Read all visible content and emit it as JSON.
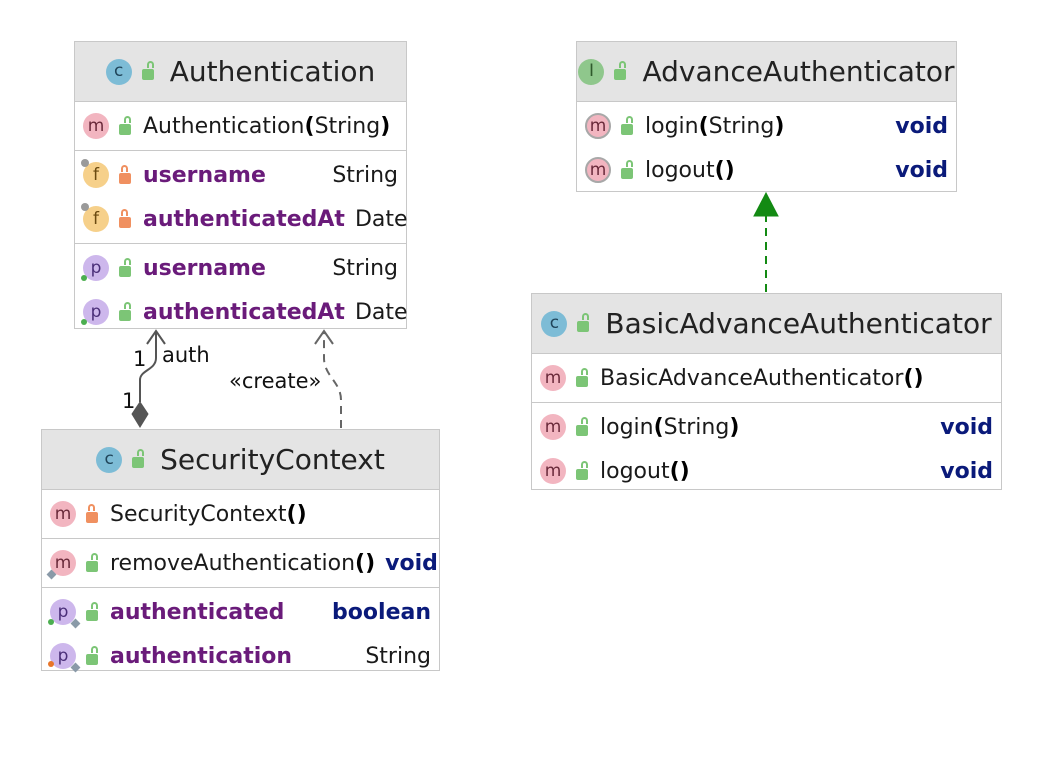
{
  "classes": {
    "authentication": {
      "name": "Authentication",
      "kind_icon": "c-class-icon",
      "constructor": {
        "name": "Authentication",
        "open": "(",
        "params": "String",
        "close": ")"
      },
      "fields": [
        {
          "name": "username",
          "type": "String"
        },
        {
          "name": "authenticatedAt",
          "type": "Date"
        }
      ],
      "properties": [
        {
          "name": "username",
          "type": "String"
        },
        {
          "name": "authenticatedAt",
          "type": "Date"
        }
      ]
    },
    "advance_authenticator": {
      "name": "AdvanceAuthenticator",
      "kind_icon": "i-interface-icon",
      "methods": [
        {
          "name": "login",
          "open": "(",
          "params": "String",
          "close": ")",
          "type": "void"
        },
        {
          "name": "logout",
          "open": "(",
          "params": "",
          "close": ")",
          "type": "void"
        }
      ]
    },
    "basic_advance_authenticator": {
      "name": "BasicAdvanceAuthenticator",
      "kind_icon": "c-class-icon",
      "constructor": {
        "name": "BasicAdvanceAuthenticator",
        "open": "(",
        "params": "",
        "close": ")"
      },
      "methods": [
        {
          "name": "login",
          "open": "(",
          "params": "String",
          "close": ")",
          "type": "void"
        },
        {
          "name": "logout",
          "open": "(",
          "params": "",
          "close": ")",
          "type": "void"
        }
      ]
    },
    "security_context": {
      "name": "SecurityContext",
      "kind_icon": "c-class-icon",
      "constructor": {
        "name": "SecurityContext",
        "open": "(",
        "params": "",
        "close": ")"
      },
      "methods": [
        {
          "name": "removeAuthentication",
          "open": "(",
          "params": "",
          "close": ")",
          "type": "void"
        }
      ],
      "properties": [
        {
          "name": "authenticated",
          "type": "boolean"
        },
        {
          "name": "authentication",
          "type": "String"
        }
      ]
    }
  },
  "glyphs": {
    "class": "c",
    "interface": "I",
    "method": "m",
    "field": "f",
    "property": "p"
  },
  "relations": {
    "composition": {
      "label": "auth",
      "source_multiplicity": "1",
      "target_multiplicity": "1"
    },
    "dependency": {
      "label": "«create»"
    },
    "realization": {
      "color": "#138a13"
    }
  }
}
